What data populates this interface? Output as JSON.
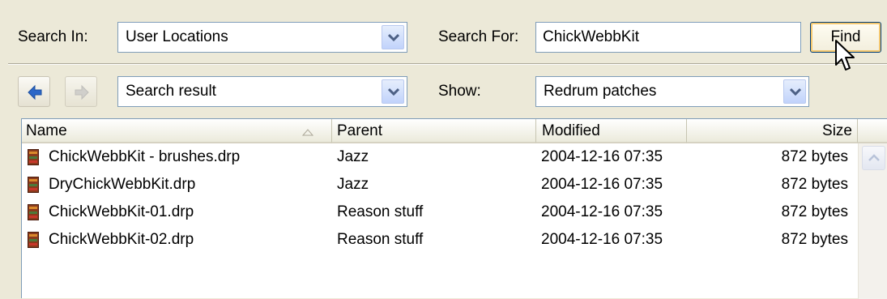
{
  "search": {
    "in_label": "Search In:",
    "in_value": "User Locations",
    "for_label": "Search For:",
    "for_value": "ChickWebbKit",
    "find_label": "Find"
  },
  "browse": {
    "location_value": "Search result",
    "show_label": "Show:",
    "show_value": "Redrum patches"
  },
  "icons": {
    "back": "back-arrow-icon",
    "forward": "forward-arrow-icon",
    "dropdown": "chevron-down-icon",
    "file": "patch-file-icon",
    "sort": "sort-ascending-icon",
    "scroll_up": "scroll-up-icon"
  },
  "colors": {
    "window_bg": "#ece9d8",
    "accent_blue": "#2c67c8",
    "file_icon": "#8a3a1c"
  },
  "table": {
    "columns": [
      "Name",
      "Parent",
      "Modified",
      "Size"
    ],
    "rows": [
      {
        "name": "ChickWebbKit - brushes.drp",
        "parent": "Jazz",
        "modified": "2004-12-16 07:35",
        "size": "872 bytes"
      },
      {
        "name": "DryChickWebbKit.drp",
        "parent": "Jazz",
        "modified": "2004-12-16 07:35",
        "size": "872 bytes"
      },
      {
        "name": "ChickWebbKit-01.drp",
        "parent": "Reason stuff",
        "modified": "2004-12-16 07:35",
        "size": "872 bytes"
      },
      {
        "name": "ChickWebbKit-02.drp",
        "parent": "Reason stuff",
        "modified": "2004-12-16 07:35",
        "size": "872 bytes"
      }
    ]
  }
}
